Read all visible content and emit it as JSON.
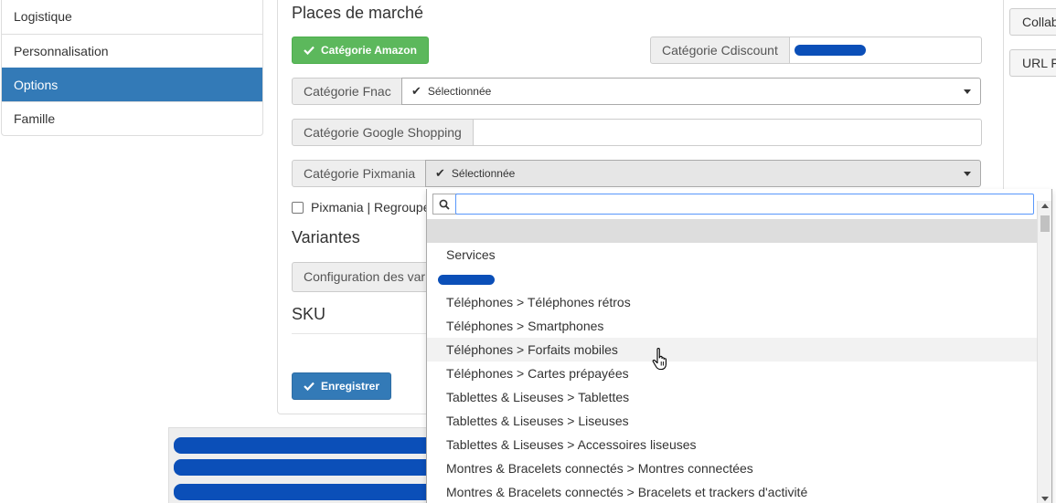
{
  "sidebar": {
    "items": [
      {
        "label": "Logistique",
        "active": false
      },
      {
        "label": "Personnalisation",
        "active": false
      },
      {
        "label": "Options",
        "active": true
      },
      {
        "label": "Famille",
        "active": false
      }
    ]
  },
  "marketplaces": {
    "title": "Places de marché",
    "amazon_button": "Catégorie Amazon",
    "cdiscount_label": "Catégorie Cdiscount",
    "fnac_label": "Catégorie Fnac",
    "fnac_value": "Sélectionnée",
    "google_label": "Catégorie Google Shopping",
    "pixmania_label": "Catégorie Pixmania",
    "pixmania_value": "Sélectionnée",
    "pixmania_group_label": "Pixmania | Regroupe"
  },
  "variants": {
    "title": "Variantes",
    "config_label": "Configuration des vari"
  },
  "sku": {
    "title": "SKU"
  },
  "save_button": "Enregistrer",
  "right_buttons": {
    "collab": "Collab",
    "url": "URL F"
  },
  "dropdown": {
    "search_value": "",
    "options": [
      "",
      "Services",
      "",
      "Téléphones > Téléphones rétros",
      "Téléphones > Smartphones",
      "Téléphones > Forfaits mobiles",
      "Téléphones > Cartes prépayées",
      "Tablettes & Liseuses > Tablettes",
      "Tablettes & Liseuses > Liseuses",
      "Tablettes & Liseuses > Accessoires liseuses",
      "Montres & Bracelets connectés > Montres connectées",
      "Montres & Bracelets connectés > Bracelets et trackers d'activité"
    ],
    "selected_index": 0,
    "hover_index": 5
  },
  "colors": {
    "active_blue": "#337ab7",
    "success_green": "#5cb85c",
    "redaction_blue": "#0b4fb8"
  },
  "icons": {
    "check": "check-icon",
    "search": "search-icon",
    "caret": "caret-down-icon",
    "pointer": "hand-pointer-icon"
  }
}
